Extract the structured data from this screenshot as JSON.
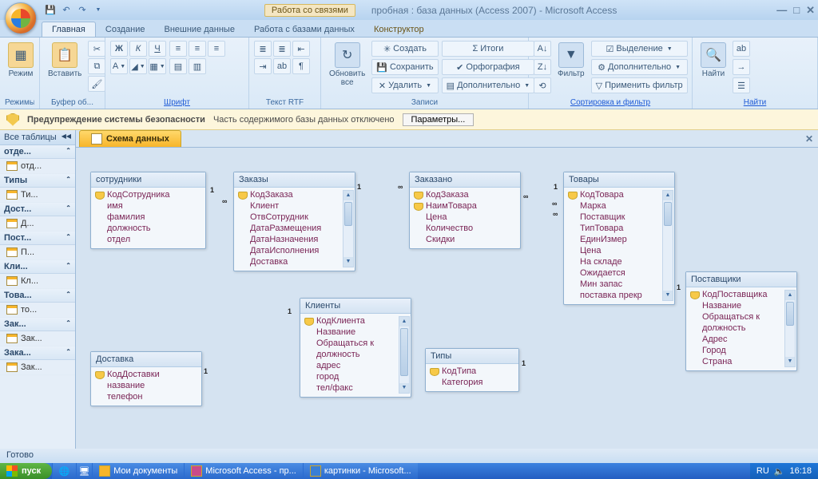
{
  "titlebar": {
    "contextual": "Работа со связями",
    "app_title": "пробная : база данных (Access 2007) - Microsoft Access"
  },
  "tabs": {
    "home": "Главная",
    "create": "Создание",
    "external": "Внешние данные",
    "dbwork": "Работа с базами данных",
    "constructor": "Конструктор"
  },
  "ribbon": {
    "modes": {
      "view": "Режим",
      "label": "Режимы"
    },
    "clip": {
      "paste": "Вставить",
      "label": "Буфер об..."
    },
    "font": {
      "b": "Ж",
      "i": "К",
      "u": "Ч",
      "label": "Шрифт"
    },
    "rtf": {
      "label": "Текст RTF"
    },
    "records": {
      "refresh": "Обновить\nвсе",
      "new": "Создать",
      "save": "Сохранить",
      "delete": "Удалить",
      "totals": "Итоги",
      "spell": "Орфография",
      "more": "Дополнительно",
      "label": "Записи"
    },
    "sort": {
      "filter": "Фильтр",
      "sel": "Выделение",
      "adv": "Дополнительно",
      "apply": "Применить фильтр",
      "label": "Сортировка и фильтр"
    },
    "find": {
      "find": "Найти",
      "label": "Найти"
    }
  },
  "security": {
    "title": "Предупреждение системы безопасности",
    "msg": "Часть содержимого базы данных отключено",
    "btn": "Параметры..."
  },
  "navpane": {
    "header": "Все таблицы",
    "groups": [
      {
        "title": "отде...",
        "items": [
          "отд..."
        ]
      },
      {
        "title": "Типы",
        "items": [
          "Ти..."
        ]
      },
      {
        "title": "Дост...",
        "items": [
          "Д..."
        ]
      },
      {
        "title": "Пост...",
        "items": [
          "П..."
        ]
      },
      {
        "title": "Кли...",
        "items": [
          "Кл..."
        ]
      },
      {
        "title": "Това...",
        "items": [
          "то..."
        ]
      },
      {
        "title": "Зак...",
        "items": [
          "Зак..."
        ]
      },
      {
        "title": "Зака...",
        "items": [
          "Зак..."
        ]
      }
    ]
  },
  "doctab": "Схема данных",
  "tables": {
    "sotrudniki": {
      "title": "сотрудники",
      "fields": [
        {
          "n": "КодСотрудника",
          "pk": true
        },
        {
          "n": "имя"
        },
        {
          "n": "фамилия"
        },
        {
          "n": "должность"
        },
        {
          "n": "отдел"
        }
      ]
    },
    "zakazy": {
      "title": "Заказы",
      "fields": [
        {
          "n": "КодЗаказа",
          "pk": true
        },
        {
          "n": "Клиент"
        },
        {
          "n": "ОтвСотрудник"
        },
        {
          "n": "ДатаРазмещения"
        },
        {
          "n": "ДатаНазначения"
        },
        {
          "n": "ДатаИсполнения"
        },
        {
          "n": "Доставка"
        }
      ]
    },
    "zakazano": {
      "title": "Заказано",
      "fields": [
        {
          "n": "КодЗаказа",
          "pk": true
        },
        {
          "n": "НаимТовара",
          "pk": true
        },
        {
          "n": "Цена"
        },
        {
          "n": "Количество"
        },
        {
          "n": "Скидки"
        }
      ]
    },
    "tovary": {
      "title": "Товары",
      "fields": [
        {
          "n": "КодТовара",
          "pk": true
        },
        {
          "n": "Марка"
        },
        {
          "n": "Поставщик"
        },
        {
          "n": "ТипТовара"
        },
        {
          "n": "ЕдинИзмер"
        },
        {
          "n": "Цена"
        },
        {
          "n": "На складе"
        },
        {
          "n": "Ожидается"
        },
        {
          "n": "Мин запас"
        },
        {
          "n": "поставка прекр"
        }
      ]
    },
    "postavshiki": {
      "title": "Поставщики",
      "fields": [
        {
          "n": "КодПоставщика",
          "pk": true
        },
        {
          "n": "Название"
        },
        {
          "n": "Обращаться к"
        },
        {
          "n": "должность"
        },
        {
          "n": "Адрес"
        },
        {
          "n": "Город"
        },
        {
          "n": "Страна"
        }
      ]
    },
    "klienty": {
      "title": "Клиенты",
      "fields": [
        {
          "n": "КодКлиента",
          "pk": true
        },
        {
          "n": "Название"
        },
        {
          "n": "Обращаться к"
        },
        {
          "n": "должность"
        },
        {
          "n": "адрес"
        },
        {
          "n": "город"
        },
        {
          "n": "тел/факс"
        }
      ]
    },
    "tipy": {
      "title": "Типы",
      "fields": [
        {
          "n": "КодТипа",
          "pk": true
        },
        {
          "n": "Категория"
        }
      ]
    },
    "dostavka": {
      "title": "Доставка",
      "fields": [
        {
          "n": "КодДоставки",
          "pk": true
        },
        {
          "n": "название"
        },
        {
          "n": "телефон"
        }
      ]
    }
  },
  "statusbar": "Готово",
  "taskbar": {
    "start": "пуск",
    "items": [
      "Мои документы",
      "Microsoft Access - пр...",
      "картинки - Microsoft..."
    ],
    "lang": "RU",
    "time": "16:18"
  }
}
